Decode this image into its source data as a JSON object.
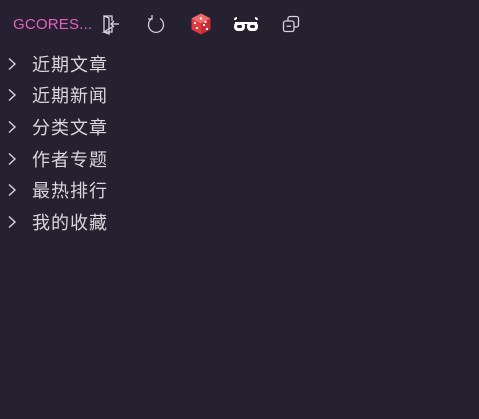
{
  "toolbar": {
    "title": "GCORES...",
    "title_color": "#e85fc3",
    "buttons": [
      {
        "icon": "sign-out-icon",
        "label": ""
      },
      {
        "icon": "refresh-icon",
        "label": ""
      },
      {
        "icon": "dice-icon",
        "label": ""
      },
      {
        "icon": "glasses-icon",
        "label": ""
      },
      {
        "icon": "collapse-all-icon",
        "label": ""
      }
    ]
  },
  "menu": {
    "items": [
      {
        "label": "近期文章",
        "icon": "chevron-right-icon"
      },
      {
        "label": "近期新闻",
        "icon": "chevron-right-icon"
      },
      {
        "label": "分类文章",
        "icon": "chevron-right-icon"
      },
      {
        "label": "作者专题",
        "icon": "chevron-right-icon"
      },
      {
        "label": "最热排行",
        "icon": "chevron-right-icon"
      },
      {
        "label": "我的收藏",
        "icon": "chevron-right-icon"
      }
    ]
  },
  "colors": {
    "background": "#252130",
    "text": "#d9d6df",
    "accent": "#e85fc3",
    "dice": "#e0393e"
  }
}
